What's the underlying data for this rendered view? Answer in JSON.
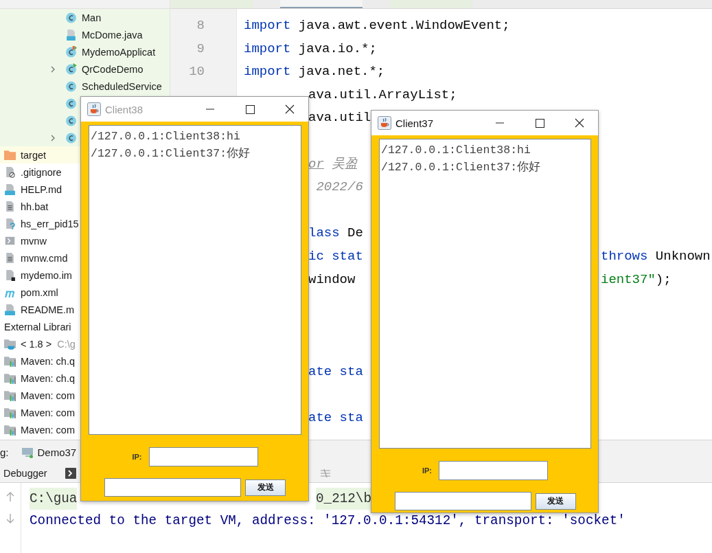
{
  "project_tree": {
    "package_items": [
      {
        "label": "Man",
        "kind": "class"
      },
      {
        "label": "McDome.java",
        "kind": "java-file"
      },
      {
        "label": "MydemoApplicat",
        "kind": "class-spring"
      },
      {
        "label": "QrCodeDemo",
        "kind": "class-run",
        "expanded": false
      },
      {
        "label": "ScheduledService",
        "kind": "class"
      },
      {
        "kind": "class"
      },
      {
        "kind": "class"
      },
      {
        "kind": "class",
        "expanded": false
      }
    ],
    "tinted": true,
    "root_items": [
      {
        "label": "target",
        "kind": "folder",
        "excluded": true
      },
      {
        "label": ".gitignore",
        "kind": "ignore-file",
        "excluded": false
      },
      {
        "label": "HELP.md",
        "kind": "md-file",
        "excluded": false
      },
      {
        "label": "hh.bat",
        "kind": "text-file",
        "excluded": false
      },
      {
        "label": "hs_err_pid15",
        "kind": "unknown-file",
        "excluded": false
      },
      {
        "label": "mvnw",
        "kind": "script-file",
        "excluded": false
      },
      {
        "label": "mvnw.cmd",
        "kind": "text-file",
        "excluded": false
      },
      {
        "label": "mydemo.im",
        "kind": "iml-file",
        "excluded": false
      },
      {
        "label": "pom.xml",
        "kind": "maven-file",
        "excluded": false
      },
      {
        "label": "README.m",
        "kind": "md-file",
        "excluded": false
      }
    ],
    "external_libraries": {
      "label": "External Librari",
      "children": [
        {
          "label": "< 1.8 >",
          "detail": "C:\\g",
          "kind": "jdk"
        },
        {
          "label": "Maven: ch.q",
          "kind": "library"
        },
        {
          "label": "Maven: ch.q",
          "kind": "library"
        },
        {
          "label": "Maven: com",
          "kind": "library"
        },
        {
          "label": "Maven: com",
          "kind": "library"
        },
        {
          "label": "Maven: com",
          "kind": "library"
        }
      ]
    }
  },
  "editor_tabs": [
    {
      "selected": false
    },
    {
      "selected": true
    },
    {
      "selected": false
    }
  ],
  "line_numbers": [
    "8",
    "9",
    "10"
  ],
  "code_lines": [
    {
      "kind": "code",
      "full": [
        {
          "kind": "keyword",
          "text": "import"
        },
        {
          "kind": "plain",
          "text": " java.awt.event.WindowEvent;"
        }
      ]
    },
    {
      "kind": "code",
      "full": [
        {
          "kind": "keyword",
          "text": "import"
        },
        {
          "kind": "plain",
          "text": " java.io.*;"
        }
      ]
    },
    {
      "kind": "code",
      "full": [
        {
          "kind": "keyword",
          "text": "import"
        },
        {
          "kind": "plain",
          "text": " java.net.*;"
        }
      ]
    },
    {
      "kind": "code",
      "left": [
        {
          "kind": "plain",
          "text": "ava.util.ArrayList;"
        }
      ]
    },
    {
      "kind": "code",
      "left": [
        {
          "kind": "plain",
          "text": "ava.util"
        }
      ]
    },
    {
      "kind": "blank"
    },
    {
      "kind": "code",
      "left": [
        {
          "kind": "doc-tag",
          "text": "or"
        },
        {
          "kind": "comment",
          "text": " 吴盈"
        }
      ]
    },
    {
      "kind": "code",
      "left": [
        {
          "kind": "comment",
          "text": " 2022/6"
        }
      ]
    },
    {
      "kind": "blank"
    },
    {
      "kind": "code",
      "left": [
        {
          "kind": "keyword",
          "text": "lass"
        },
        {
          "kind": "plain",
          "text": " De"
        }
      ]
    },
    {
      "kind": "code",
      "left": [
        {
          "kind": "keyword",
          "text": "ic stat"
        }
      ],
      "right": [
        {
          "kind": "keyword",
          "text": "throws"
        },
        {
          "kind": "plain",
          "text": " Unknown"
        }
      ]
    },
    {
      "kind": "code",
      "left": [
        {
          "kind": "plain",
          "text": "window"
        }
      ],
      "right": [
        {
          "kind": "string",
          "text": "ient37\""
        },
        {
          "kind": "plain",
          "text": ");"
        }
      ]
    },
    {
      "kind": "blank"
    },
    {
      "kind": "blank"
    },
    {
      "kind": "blank"
    },
    {
      "kind": "code",
      "left": [
        {
          "kind": "keyword",
          "text": "ate sta"
        }
      ]
    },
    {
      "kind": "blank"
    },
    {
      "kind": "code",
      "left": [
        {
          "kind": "keyword",
          "text": "ate sta"
        }
      ]
    }
  ],
  "debug_bar": {
    "label": "g:",
    "session": "Demo37"
  },
  "tool_tabs": [
    {
      "label": "Debugger"
    }
  ],
  "console_lines": [
    {
      "kind": "command",
      "left": "C:\\gua",
      "right": "0_212\\b"
    },
    {
      "kind": "info",
      "left": "Connected to the target VM, address: '127.0.0.1:54312', transport: 'socket'"
    }
  ],
  "windows": [
    {
      "title": "Client38",
      "active": false,
      "messages": [
        "/127.0.0.1:Client38:hi",
        "/127.0.0.1:Client37:你好"
      ],
      "ip_label": "IP:",
      "send_button": "发送"
    },
    {
      "title": "Client37",
      "active": true,
      "messages": [
        "/127.0.0.1:Client38:hi",
        "/127.0.0.1:Client37:你好"
      ],
      "ip_label": "IP:",
      "send_button": "发送"
    }
  ]
}
